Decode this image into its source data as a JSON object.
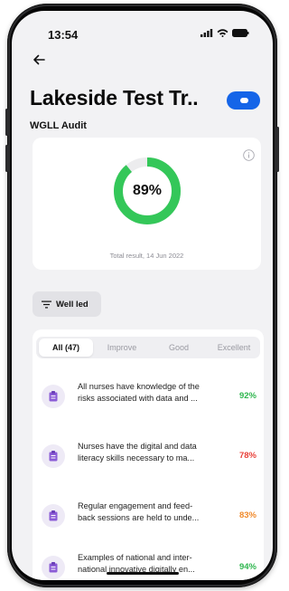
{
  "status_bar": {
    "time": "13:54",
    "icons": [
      "signal-icon",
      "wifi-icon",
      "battery-icon"
    ]
  },
  "header": {
    "back_icon": "arrow-left-icon",
    "title": "Lakeside Test Tr..",
    "subtitle": "WGLL Audit",
    "toggle_on": true
  },
  "result": {
    "percent_label": "89%",
    "percent_value": 0.89,
    "caption": "Total result, 14 Jun 2022",
    "info_icon": "info-icon"
  },
  "filter": {
    "label": "Well led",
    "icon": "filter-lines-icon"
  },
  "tabs": [
    {
      "label": "All (47)",
      "active": true
    },
    {
      "label": "Improve",
      "active": false
    },
    {
      "label": "Good",
      "active": false
    },
    {
      "label": "Excellent",
      "active": false
    }
  ],
  "items": [
    {
      "line1": "All nurses have knowledge of the",
      "line2": "risks associated with data and ...",
      "score": "92%",
      "score_color": "#2fb64f",
      "icon": "clipboard-icon"
    },
    {
      "line1": "Nurses have the digital and data",
      "line2": "literacy skills necessary to ma...",
      "score": "78%",
      "score_color": "#e8413a",
      "icon": "clipboard-icon"
    },
    {
      "line1": "Regular engagement and feed-",
      "line2": "back sessions are held to unde...",
      "score": "83%",
      "score_color": "#f0892a",
      "icon": "clipboard-icon"
    },
    {
      "line1": "Examples of national and inter-",
      "line2": "national innovative digitally en...",
      "score": "94%",
      "score_color": "#2fb64f",
      "icon": "clipboard-icon"
    }
  ],
  "colors": {
    "accent": "#1565e8",
    "progress": "#34c759",
    "progress_track": "#ececee",
    "icon_purple": "#8b5cd6"
  }
}
